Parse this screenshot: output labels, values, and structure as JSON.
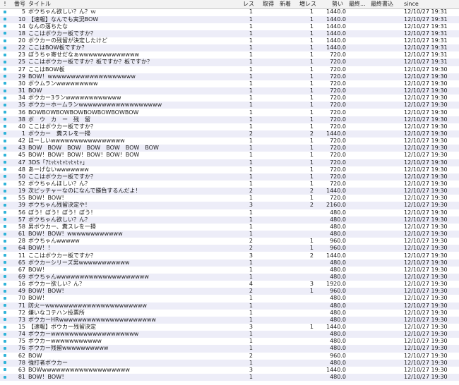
{
  "header": {
    "mark": "!",
    "num": "番号",
    "title": "タイトル",
    "res": "レス",
    "get": "取得",
    "new": "新着",
    "inc": "増レス",
    "momentum": "勢い",
    "last": "最終...",
    "last_write": "最終書込",
    "since": "since"
  },
  "colors": {
    "marker": "#2fb3d8",
    "alt_row": "#ededf8"
  },
  "rows": [
    {
      "num": "5",
      "title": "ボウちゃん欲しい？ん？ｗ",
      "res": "1",
      "inc": "1",
      "mom": "1440.0",
      "since": "12/10/27 19:31"
    },
    {
      "num": "10",
      "title": "【速報】なんでも実況BOW",
      "res": "1",
      "inc": "1",
      "mom": "1440.0",
      "since": "12/10/27 19:31"
    },
    {
      "num": "14",
      "title": "なんの落ちたな",
      "res": "1",
      "inc": "1",
      "mom": "1440.0",
      "since": "12/10/27 19:31"
    },
    {
      "num": "18",
      "title": "ここはボウカー板ですか？",
      "res": "1",
      "inc": "1",
      "mom": "1440.0",
      "since": "12/10/27 19:31"
    },
    {
      "num": "20",
      "title": "ボウカーの残留が決定したけど",
      "res": "1",
      "inc": "1",
      "mom": "1440.0",
      "since": "12/10/27 19:31"
    },
    {
      "num": "22",
      "title": "ここはBOW板ですか？",
      "res": "1",
      "inc": "1",
      "mom": "1440.0",
      "since": "12/10/27 19:31"
    },
    {
      "num": "23",
      "title": "ぼうちゃ寄せだなぁwwwwwwwwwwwww",
      "res": "1",
      "inc": "1",
      "mom": "720.0",
      "since": "12/10/27 19:31"
    },
    {
      "num": "25",
      "title": "ここはボウカー板ですか？板ですか？板ですか？",
      "res": "1",
      "inc": "1",
      "mom": "720.0",
      "since": "12/10/27 19:31"
    },
    {
      "num": "27",
      "title": "ここはBOW板",
      "res": "1",
      "inc": "1",
      "mom": "720.0",
      "since": "12/10/27 19:30"
    },
    {
      "num": "29",
      "title": "BOW！wwwwwwwwwwwwwwwwwww",
      "res": "1",
      "inc": "1",
      "mom": "720.0",
      "since": "12/10/27 19:30"
    },
    {
      "num": "30",
      "title": "ボウムランwwwwwwwww",
      "res": "1",
      "inc": "1",
      "mom": "720.0",
      "since": "12/10/27 19:30"
    },
    {
      "num": "31",
      "title": "BOW",
      "res": "1",
      "inc": "1",
      "mom": "720.0",
      "since": "12/10/27 19:30"
    },
    {
      "num": "34",
      "title": "ボウカー3ランwwwwwwwwwwww",
      "res": "1",
      "inc": "1",
      "mom": "720.0",
      "since": "12/10/27 19:30"
    },
    {
      "num": "35",
      "title": "ボウカーホームランwwwwwwwwwwwwwwwwww",
      "res": "1",
      "inc": "1",
      "mom": "720.0",
      "since": "12/10/27 19:30"
    },
    {
      "num": "36",
      "title": "BOWBOWBOWBOWBOWBOWBOWBOW",
      "res": "1",
      "inc": "1",
      "mom": "720.0",
      "since": "12/10/27 19:30"
    },
    {
      "num": "38",
      "title": "ボ　ウ　カ　ー　残　留",
      "res": "1",
      "inc": "1",
      "mom": "720.0",
      "since": "12/10/27 19:30"
    },
    {
      "num": "40",
      "title": "ここはボウカー板ですか？",
      "res": "1",
      "inc": "1",
      "mom": "720.0",
      "since": "12/10/27 19:30"
    },
    {
      "num": "1",
      "title": "ボウカー　糞スレを一掃",
      "res": "2",
      "inc": "2",
      "mom": "1440.0",
      "since": "12/10/27 19:30"
    },
    {
      "num": "42",
      "title": "ほーしいwwwwwwwwwwwwwwww",
      "res": "1",
      "inc": "1",
      "mom": "720.0",
      "since": "12/10/27 19:30"
    },
    {
      "num": "43",
      "title": "BOW　BOW　BOW　BOW　BOW　BOW　BOW",
      "res": "1",
      "inc": "1",
      "mom": "720.0",
      "since": "12/10/27 19:30"
    },
    {
      "num": "45",
      "title": "BOW！BOW！BOW！BOW！BOW！BOW",
      "res": "1",
      "inc": "1",
      "mom": "720.0",
      "since": "12/10/27 19:30"
    },
    {
      "num": "47",
      "title": "3DS「ｱﾋｬﾋｬﾋｬﾋｬﾋｬﾋｬ」",
      "res": "1",
      "inc": "1",
      "mom": "720.0",
      "since": "12/10/27 19:30"
    },
    {
      "num": "48",
      "title": "あーげないwwwwwww",
      "res": "1",
      "inc": "1",
      "mom": "720.0",
      "since": "12/10/27 19:30"
    },
    {
      "num": "50",
      "title": "ここはボウカー板ですか？",
      "res": "1",
      "inc": "1",
      "mom": "720.0",
      "since": "12/10/27 19:30"
    },
    {
      "num": "52",
      "title": "ボウちゃんほしい？ん？",
      "res": "1",
      "inc": "1",
      "mom": "720.0",
      "since": "12/10/27 19:30"
    },
    {
      "num": "19",
      "title": "次ピッチャーなのになんで勝負するんだよ！",
      "res": "2",
      "inc": "2",
      "mom": "1440.0",
      "since": "12/10/27 19:30"
    },
    {
      "num": "55",
      "title": "BOW！BOW！",
      "res": "1",
      "inc": "1",
      "mom": "720.0",
      "since": "12/10/27 19:30"
    },
    {
      "num": "39",
      "title": "ボウちゃん残留決定や！",
      "res": "3",
      "inc": "2",
      "mom": "2160.0",
      "since": "12/10/27 19:30"
    },
    {
      "num": "56",
      "title": "ぼう！ぼう！ぼう！ぼう！",
      "res": "1",
      "inc": "",
      "mom": "480.0",
      "since": "12/10/27 19:30"
    },
    {
      "num": "57",
      "title": "ボウちゃん欲しい？ん？",
      "res": "1",
      "inc": "",
      "mom": "480.0",
      "since": "12/10/27 19:30"
    },
    {
      "num": "58",
      "title": "男ボウカー、糞スレを一掃",
      "res": "1",
      "inc": "",
      "mom": "480.0",
      "since": "12/10/27 19:30"
    },
    {
      "num": "61",
      "title": "BOW！BOW！wwwwwwwwwwww",
      "res": "1",
      "inc": "",
      "mom": "480.0",
      "since": "12/10/27 19:30"
    },
    {
      "num": "28",
      "title": "ボウちゃんwwwww",
      "res": "2",
      "inc": "1",
      "mom": "960.0",
      "since": "12/10/27 19:30"
    },
    {
      "num": "64",
      "title": "BOW！！",
      "res": "2",
      "inc": "1",
      "mom": "960.0",
      "since": "12/10/27 19:30"
    },
    {
      "num": "11",
      "title": "ここはボウカー板ですか？",
      "res": "3",
      "inc": "2",
      "mom": "1440.0",
      "since": "12/10/27 19:30"
    },
    {
      "num": "65",
      "title": "ボウカーシリーズ男wwwwwwwwwww",
      "res": "1",
      "inc": "",
      "mom": "480.0",
      "since": "12/10/27 19:30"
    },
    {
      "num": "67",
      "title": "BOW！",
      "res": "1",
      "inc": "",
      "mom": "480.0",
      "since": "12/10/27 19:30"
    },
    {
      "num": "69",
      "title": "ボウちゃんwwwwwwwwwwwwwwwwwwww",
      "res": "1",
      "inc": "",
      "mom": "480.0",
      "since": "12/10/27 19:30"
    },
    {
      "num": "16",
      "title": "ボウカー欲しい？ん？",
      "res": "4",
      "inc": "3",
      "mom": "1920.0",
      "since": "12/10/27 19:30"
    },
    {
      "num": "49",
      "title": "BOW！BOW！",
      "res": "2",
      "inc": "1",
      "mom": "960.0",
      "since": "12/10/27 19:30"
    },
    {
      "num": "70",
      "title": "BOW！",
      "res": "1",
      "inc": "",
      "mom": "480.0",
      "since": "12/10/27 19:30"
    },
    {
      "num": "71",
      "title": "防火ーwwwwwwwwwwwwwwwwwwwwww",
      "res": "1",
      "inc": "",
      "mom": "480.0",
      "since": "12/10/27 19:30"
    },
    {
      "num": "72",
      "title": "嫌いなコテハン投票所",
      "res": "1",
      "inc": "",
      "mom": "480.0",
      "since": "12/10/27 19:30"
    },
    {
      "num": "73",
      "title": "ボウカーHRwwwwwwwwwwwwwwwwwwwww",
      "res": "1",
      "inc": "",
      "mom": "480.0",
      "since": "12/10/27 19:30"
    },
    {
      "num": "15",
      "title": "【速報】ボウカー残留決定",
      "res": "3",
      "inc": "1",
      "mom": "1440.0",
      "since": "12/10/27 19:30"
    },
    {
      "num": "74",
      "title": "ボウカーwwwwwwwwwwwwwwwwwww",
      "res": "1",
      "inc": "",
      "mom": "480.0",
      "since": "12/10/27 19:30"
    },
    {
      "num": "75",
      "title": "ボウカーwwwwwwwwwww",
      "res": "1",
      "inc": "",
      "mom": "480.0",
      "since": "12/10/27 19:30"
    },
    {
      "num": "76",
      "title": "ボウカー残留wwwwwwwwww",
      "res": "1",
      "inc": "",
      "mom": "480.0",
      "since": "12/10/27 19:30"
    },
    {
      "num": "62",
      "title": "BOW",
      "res": "2",
      "inc": "",
      "mom": "960.0",
      "since": "12/10/27 19:30"
    },
    {
      "num": "78",
      "title": "強打者ボウカー",
      "res": "1",
      "inc": "",
      "mom": "480.0",
      "since": "12/10/27 19:30"
    },
    {
      "num": "63",
      "title": "BOWwwwwwwwwwwwwwwwwwww",
      "res": "3",
      "inc": "",
      "mom": "1440.0",
      "since": "12/10/27 19:30"
    },
    {
      "num": "81",
      "title": "BOW！BOW！",
      "res": "1",
      "inc": "",
      "mom": "480.0",
      "since": "12/10/27 19:30"
    }
  ]
}
